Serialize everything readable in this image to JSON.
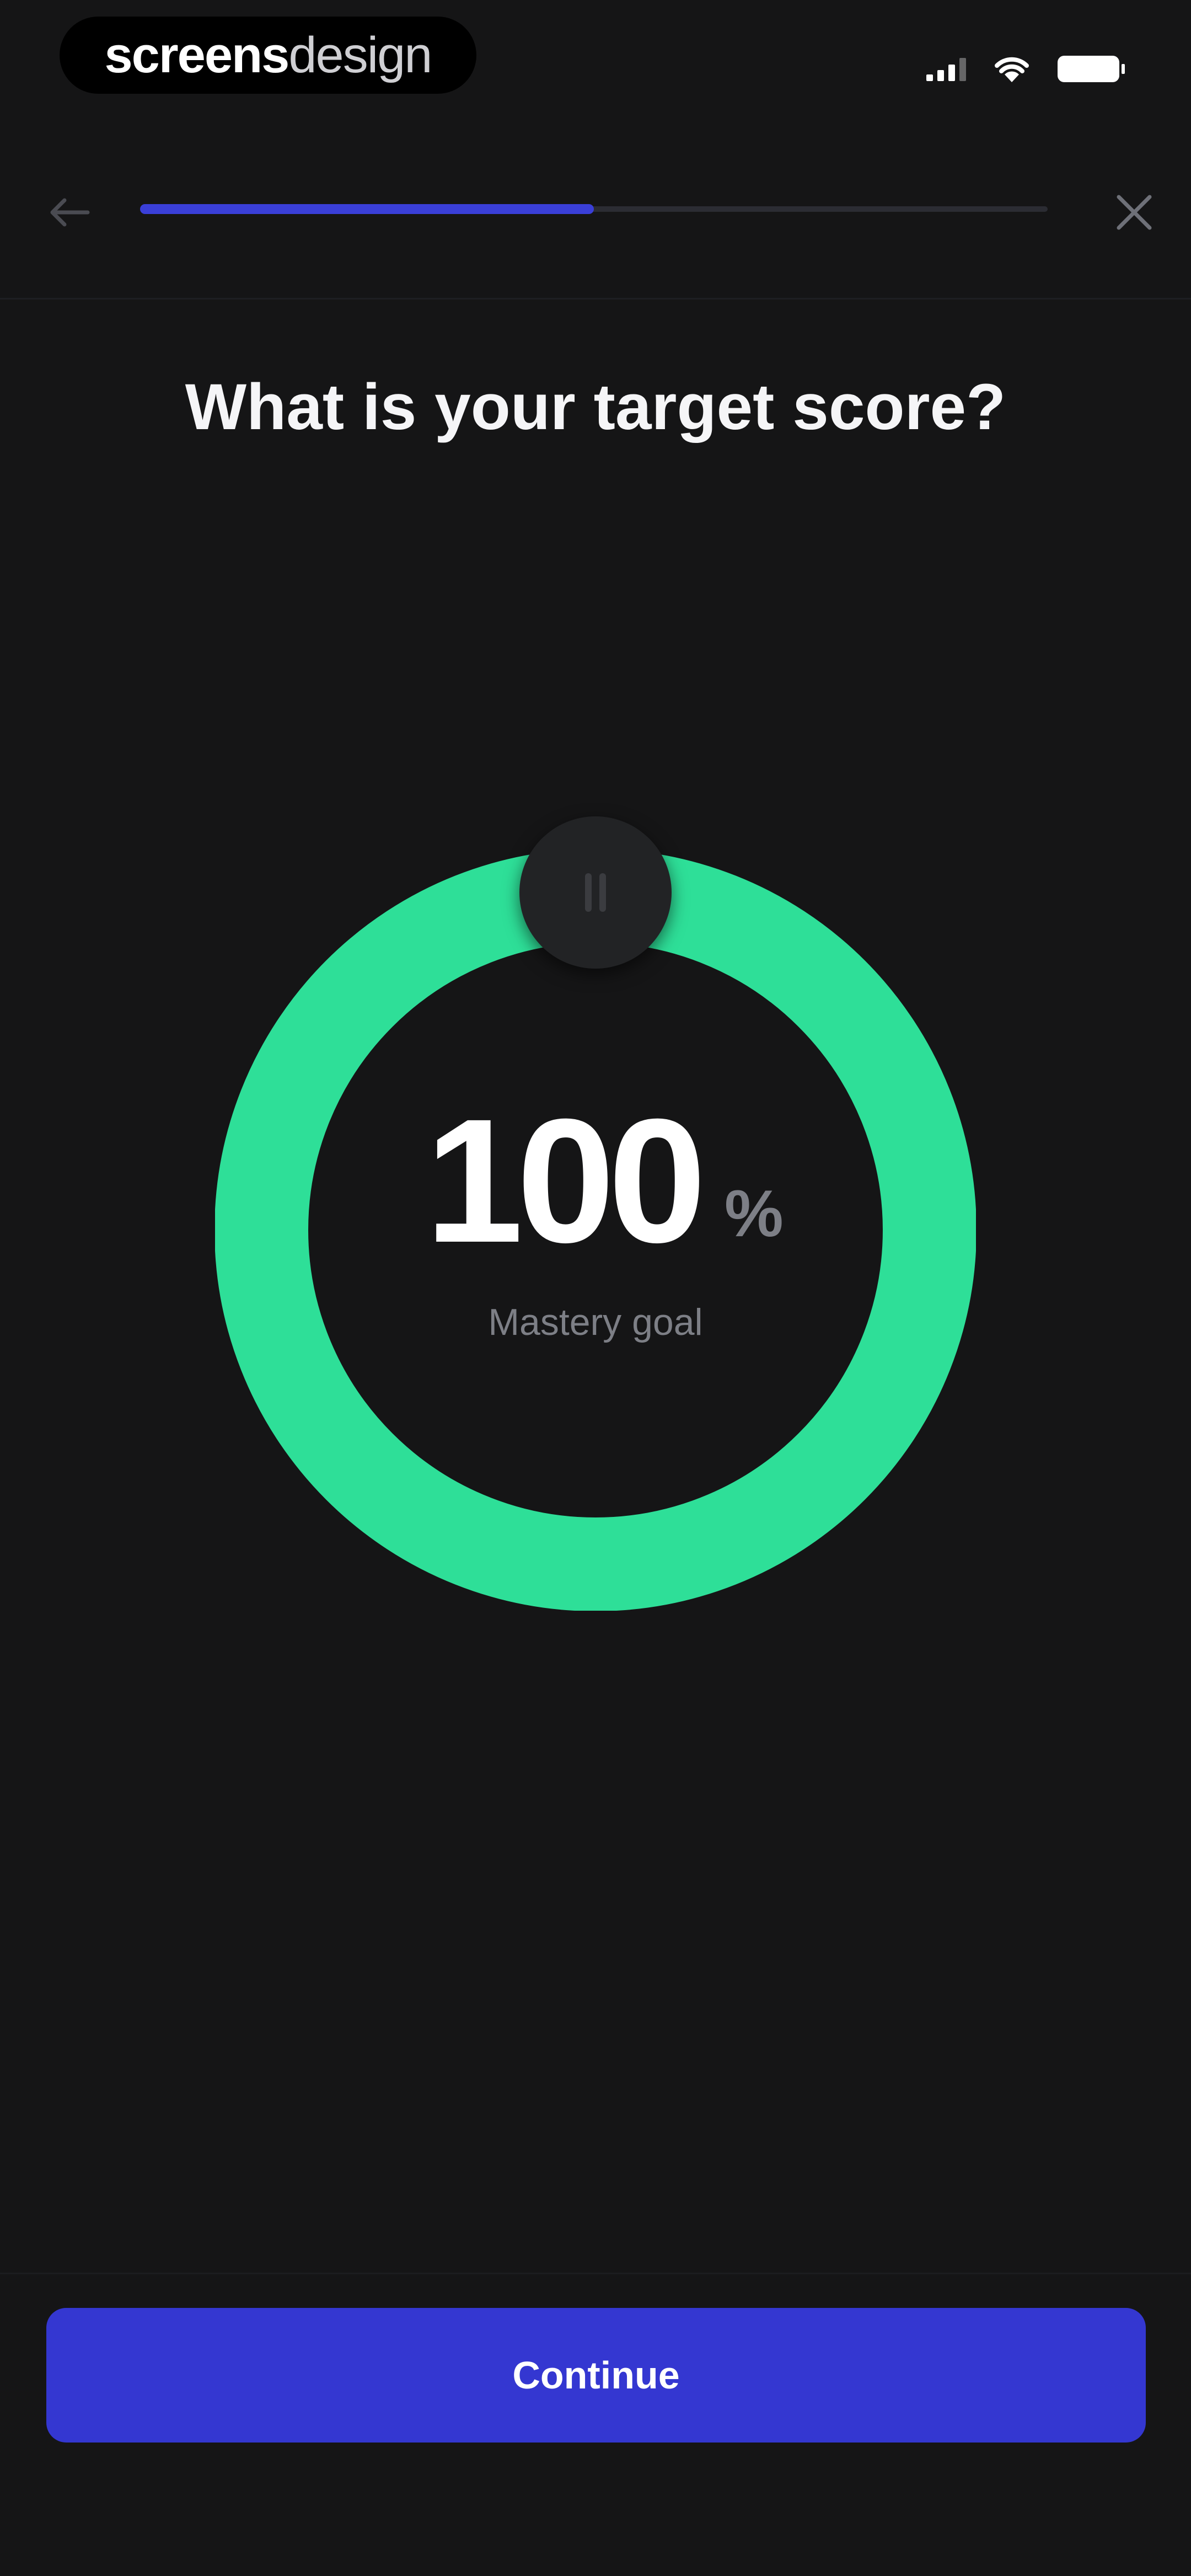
{
  "status_bar": {
    "brand_part1": "screens",
    "brand_part2": "design"
  },
  "header": {
    "back_icon": "arrow-left-icon",
    "close_icon": "close-icon",
    "progress": 0.5,
    "progress_color": "#3A3FD8"
  },
  "question": {
    "title": "What is your target score?"
  },
  "score_dial": {
    "value": "100",
    "unit": "%",
    "label": "Mastery goal",
    "percent": 100,
    "ring_color": "#2EDF98"
  },
  "footer": {
    "continue_label": "Continue",
    "button_color": "#3437D1"
  }
}
